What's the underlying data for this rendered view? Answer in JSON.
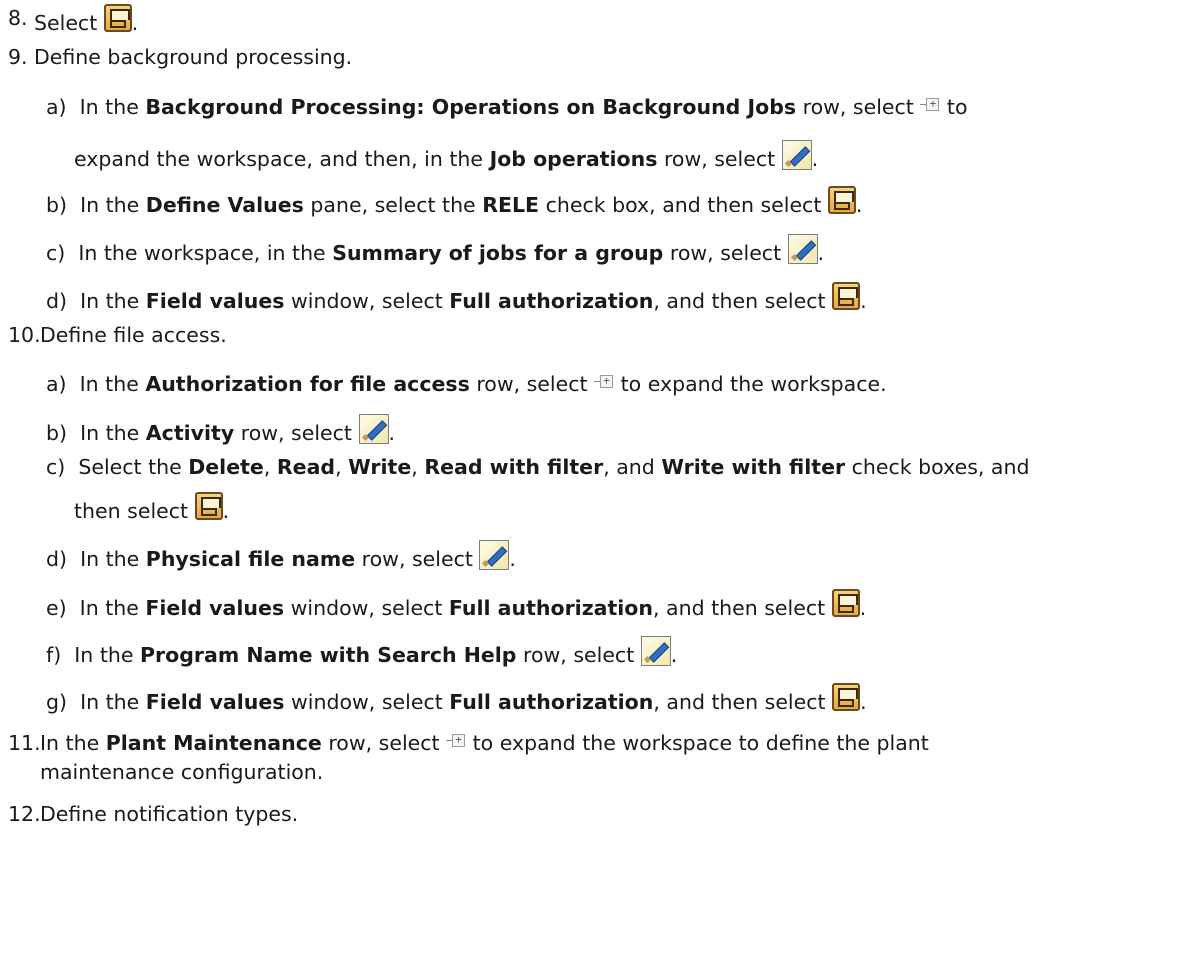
{
  "steps": {
    "s8": {
      "num": "8.",
      "text": "Select",
      "end": "."
    },
    "s9": {
      "num": "9.",
      "text": "Define background processing."
    },
    "s9a": {
      "letter": "a)",
      "t1": "In the",
      "b1": "Background Processing: Operations on Background Jobs",
      "t2": "row, select",
      "t3": "to"
    },
    "s9a2": {
      "t1": "expand the workspace, and then, in the",
      "b1": "Job operations",
      "t2": "row, select",
      "end": "."
    },
    "s9b": {
      "letter": "b)",
      "t1": "In the",
      "b1": "Define Values",
      "t2": "pane, select the",
      "b2": "RELE",
      "t3": "check box, and then select",
      "end": "."
    },
    "s9c": {
      "letter": "c)",
      "t1": "In the workspace, in the",
      "b1": "Summary of jobs for a group",
      "t2": "row, select",
      "end": "."
    },
    "s9d": {
      "letter": "d)",
      "t1": "In the",
      "b1": "Field values",
      "t2": "window, select",
      "b2": "Full authorization",
      "t3": ", and then select",
      "end": "."
    },
    "s10": {
      "num": "10.",
      "text": "Define file access."
    },
    "s10a": {
      "letter": "a)",
      "t1": "In the",
      "b1": "Authorization for file access",
      "t2": "row, select",
      "t3": "to expand the workspace."
    },
    "s10b": {
      "letter": "b)",
      "t1": "In the",
      "b1": "Activity",
      "t2": "row, select",
      "end": "."
    },
    "s10c": {
      "letter": "c)",
      "t1": "Select the",
      "b1": "Delete",
      "s1": ",",
      "b2": "Read",
      "s2": ",",
      "b3": "Write",
      "s3": ",",
      "b4": "Read with filter",
      "t2": ", and",
      "b5": "Write with filter",
      "t3": "check boxes, and"
    },
    "s10c2": {
      "t1": "then select",
      "end": "."
    },
    "s10d": {
      "letter": "d)",
      "t1": "In the",
      "b1": "Physical file name",
      "t2": "row, select",
      "end": "."
    },
    "s10e": {
      "letter": "e)",
      "t1": "In the",
      "b1": "Field values",
      "t2": "window, select",
      "b2": "Full authorization",
      "t3": ", and then select",
      "end": "."
    },
    "s10f": {
      "letter": "f)",
      "t1": "In the",
      "b1": "Program Name with Search Help",
      "t2": "row, select",
      "end": "."
    },
    "s10g": {
      "letter": "g)",
      "t1": "In the",
      "b1": "Field values",
      "t2": "window, select",
      "b2": "Full authorization",
      "t3": ", and then select",
      "end": "."
    },
    "s11": {
      "num": "11.",
      "t1": "In the",
      "b1": "Plant Maintenance",
      "t2": "row, select",
      "t3": "to expand the workspace to define the plant"
    },
    "s11b": {
      "text": "maintenance configuration."
    },
    "s12": {
      "num": "12.",
      "text": "Define notification types."
    }
  },
  "icons": {
    "save": "save-icon",
    "edit": "pencil-edit-icon",
    "expand": "expand-node-icon"
  }
}
